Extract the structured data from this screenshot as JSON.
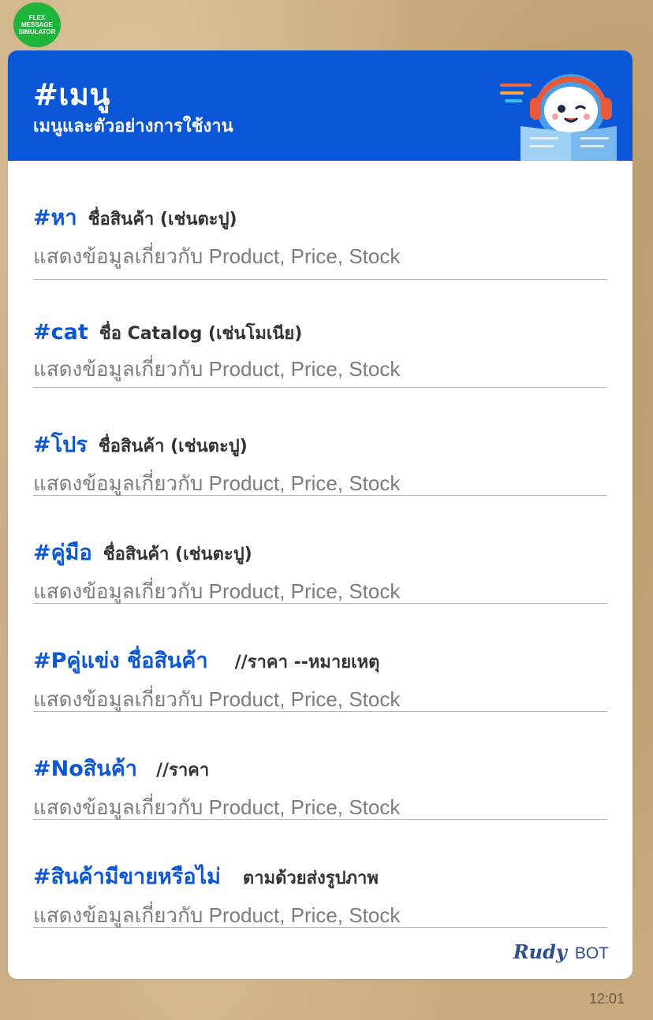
{
  "badge": {
    "label": "FLEX\nMESSAGE\nSIMULATOR"
  },
  "header": {
    "title": "#เมนู",
    "subtitle": "เมนูและตัวอย่างการใช้งาน"
  },
  "menu": {
    "items": [
      {
        "command": "#หา",
        "argument": "ชื่อสินค้า (เช่นตะปู)",
        "description": "แสดงข้อมูลเกี่ยวกับ Product, Price, Stock"
      },
      {
        "command": "#cat",
        "argument": "ชื่อ Catalog (เช่นโมเนีย)",
        "description": "แสดงข้อมูลเกี่ยวกับ Product, Price, Stock"
      },
      {
        "command": "#โปร",
        "argument": "ชื่อสินค้า (เช่นตะปู)",
        "description": "แสดงข้อมูลเกี่ยวกับ Product, Price, Stock"
      },
      {
        "command": "#คู่มือ",
        "argument": "ชื่อสินค้า (เช่นตะปู)",
        "description": "แสดงข้อมูลเกี่ยวกับ Product, Price, Stock"
      },
      {
        "command": "#Pคู่แข่ง ชื่อสินค้า",
        "argument": "//ราคา --หมายเหตุ",
        "description": "แสดงข้อมูลเกี่ยวกับ Product, Price, Stock"
      },
      {
        "command": "#Noสินค้า",
        "argument": "//ราคา",
        "description": "แสดงข้อมูลเกี่ยวกับ Product, Price, Stock"
      },
      {
        "command": "#สินค้ามีขายหรือไม่",
        "argument": "ตามด้วยส่งรูปภาพ",
        "description": "แสดงข้อมูลเกี่ยวกับ Product, Price, Stock"
      }
    ]
  },
  "footer": {
    "brand": "Rudy",
    "suffix": "BOT"
  },
  "message": {
    "time": "12:01"
  },
  "colors": {
    "accent": "#0a56d6",
    "background": "#c9ab7f",
    "badge": "#1fb53c"
  },
  "icons": {
    "mascot": "headphone-robot-reading-book-icon"
  }
}
